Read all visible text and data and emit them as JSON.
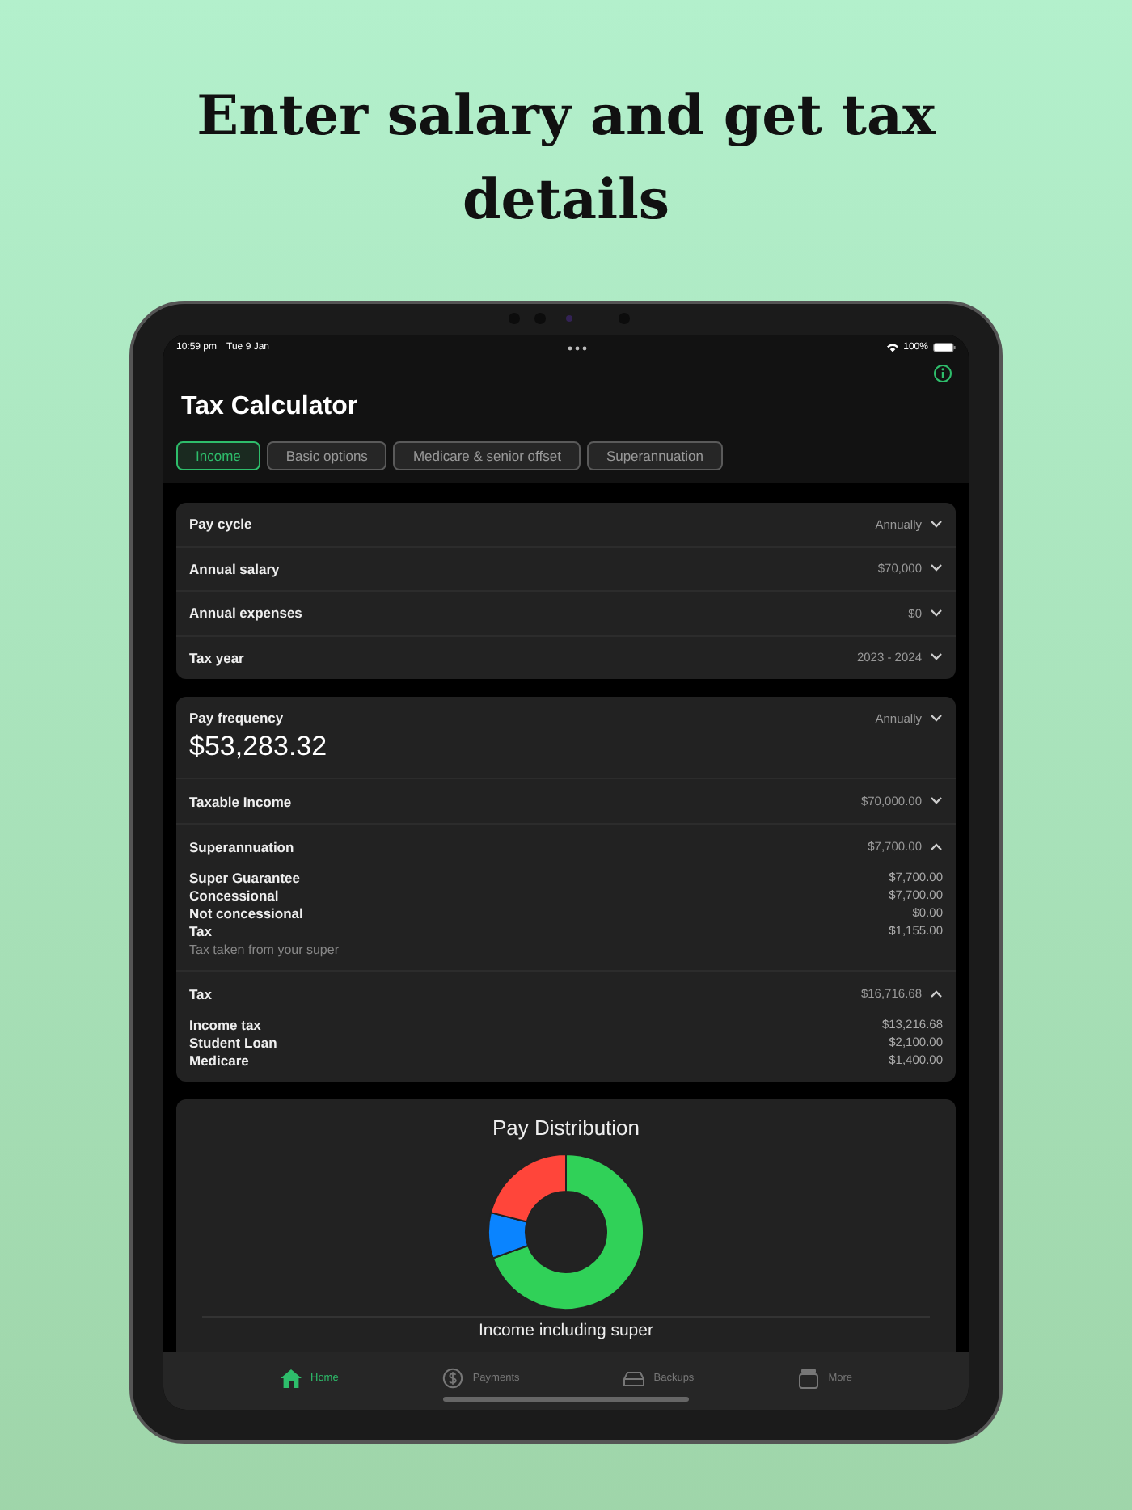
{
  "headline": "Enter salary and get tax details",
  "status_bar": {
    "time": "10:59 pm",
    "date": "Tue 9 Jan",
    "battery": "100%"
  },
  "title": "Tax Calculator",
  "tabs": [
    {
      "label": "Income",
      "selected": true
    },
    {
      "label": "Basic options",
      "selected": false
    },
    {
      "label": "Medicare & senior offset",
      "selected": false
    },
    {
      "label": "Superannuation",
      "selected": false
    }
  ],
  "settings_rows": [
    {
      "label": "Pay cycle",
      "value": "Annually"
    },
    {
      "label": "Annual salary",
      "value": "$70,000"
    },
    {
      "label": "Annual expenses",
      "value": "$0"
    },
    {
      "label": "Tax year",
      "value": "2023 - 2024"
    }
  ],
  "pay_frequency": {
    "label": "Pay frequency",
    "value": "Annually",
    "amount": "$53,283.32"
  },
  "sections": [
    {
      "label": "Taxable Income",
      "value": "$70,000.00",
      "expanded": false
    },
    {
      "label": "Superannuation",
      "value": "$7,700.00",
      "expanded": true,
      "items": [
        {
          "label": "Super Guarantee",
          "value": "$7,700.00"
        },
        {
          "label": "Concessional",
          "value": "$7,700.00"
        },
        {
          "label": "Not concessional",
          "value": "$0.00"
        },
        {
          "label": "Tax",
          "value": "$1,155.00"
        }
      ],
      "note": "Tax taken from your super"
    },
    {
      "label": "Tax",
      "value": "$16,716.68",
      "expanded": true,
      "items": [
        {
          "label": "Income tax",
          "value": "$13,216.68"
        },
        {
          "label": "Student Loan",
          "value": "$2,100.00"
        },
        {
          "label": "Medicare",
          "value": "$1,400.00"
        }
      ]
    }
  ],
  "chart_card": {
    "title": "Pay Distribution",
    "subtitle": "Income including super"
  },
  "tab_bar": [
    {
      "label": "Home",
      "selected": true
    },
    {
      "label": "Payments",
      "selected": false
    },
    {
      "label": "Backups",
      "selected": false
    },
    {
      "label": "More",
      "selected": false
    }
  ]
}
